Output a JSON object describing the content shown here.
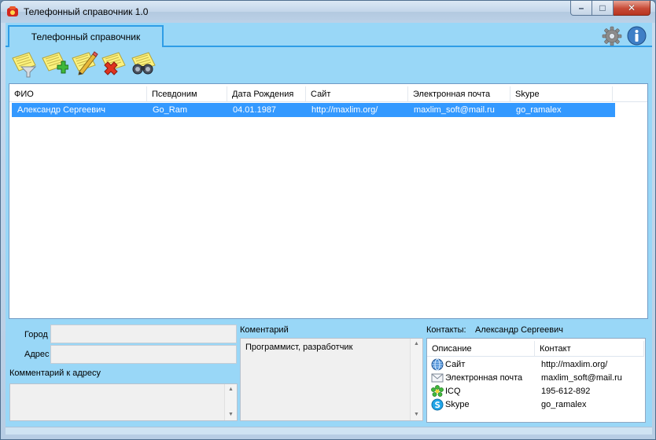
{
  "window": {
    "title": "Телефонный справочник 1.0",
    "minimize_glyph": "–",
    "maximize_glyph": "□",
    "close_glyph": "✕"
  },
  "tabs": [
    {
      "label": "Телефонный справочник",
      "selected": true
    }
  ],
  "header_icons": [
    "gear-icon",
    "info-icon"
  ],
  "toolbar": {
    "buttons": [
      {
        "icon": "filter-icon",
        "action": "filter"
      },
      {
        "icon": "add-record-icon",
        "action": "add"
      },
      {
        "icon": "edit-record-icon",
        "action": "edit"
      },
      {
        "icon": "delete-record-icon",
        "action": "delete"
      },
      {
        "icon": "binoculars-icon",
        "action": "search"
      }
    ]
  },
  "grid": {
    "columns": [
      "ФИО",
      "Псевдоним",
      "Дата Рождения",
      "Сайт",
      "Электронная почта",
      "Skype"
    ],
    "rows": [
      [
        "Александр Сергеевич",
        "Go_Ram",
        "04.01.1987",
        "http://maxlim.org/",
        "maxlim_soft@mail.ru",
        "go_ramalex"
      ]
    ],
    "selected_row": 0
  },
  "address": {
    "city_label": "Город",
    "city_value": "",
    "address_label": "Адрес",
    "address_value": "",
    "comment_label": "Комментарий к адресу",
    "comment_value": ""
  },
  "comment": {
    "label": "Коментарий",
    "value": "Программист, разработчик"
  },
  "contacts": {
    "label": "Контакты:",
    "person": "Александр Сергеевич",
    "columns": [
      "Описание",
      "Контакт"
    ],
    "rows": [
      {
        "icon": "globe-icon",
        "description": "Сайт",
        "value": "http://maxlim.org/"
      },
      {
        "icon": "envelope-icon",
        "description": "Электронная почта",
        "value": "maxlim_soft@mail.ru"
      },
      {
        "icon": "icq-flower-icon",
        "description": "ICQ",
        "value": "195-612-892"
      },
      {
        "icon": "skype-icon",
        "description": "Skype",
        "value": "go_ramalex"
      }
    ]
  },
  "colors": {
    "client_background": "#99d7f7",
    "tab_border": "#2f9de6",
    "selection": "#3399ff"
  }
}
